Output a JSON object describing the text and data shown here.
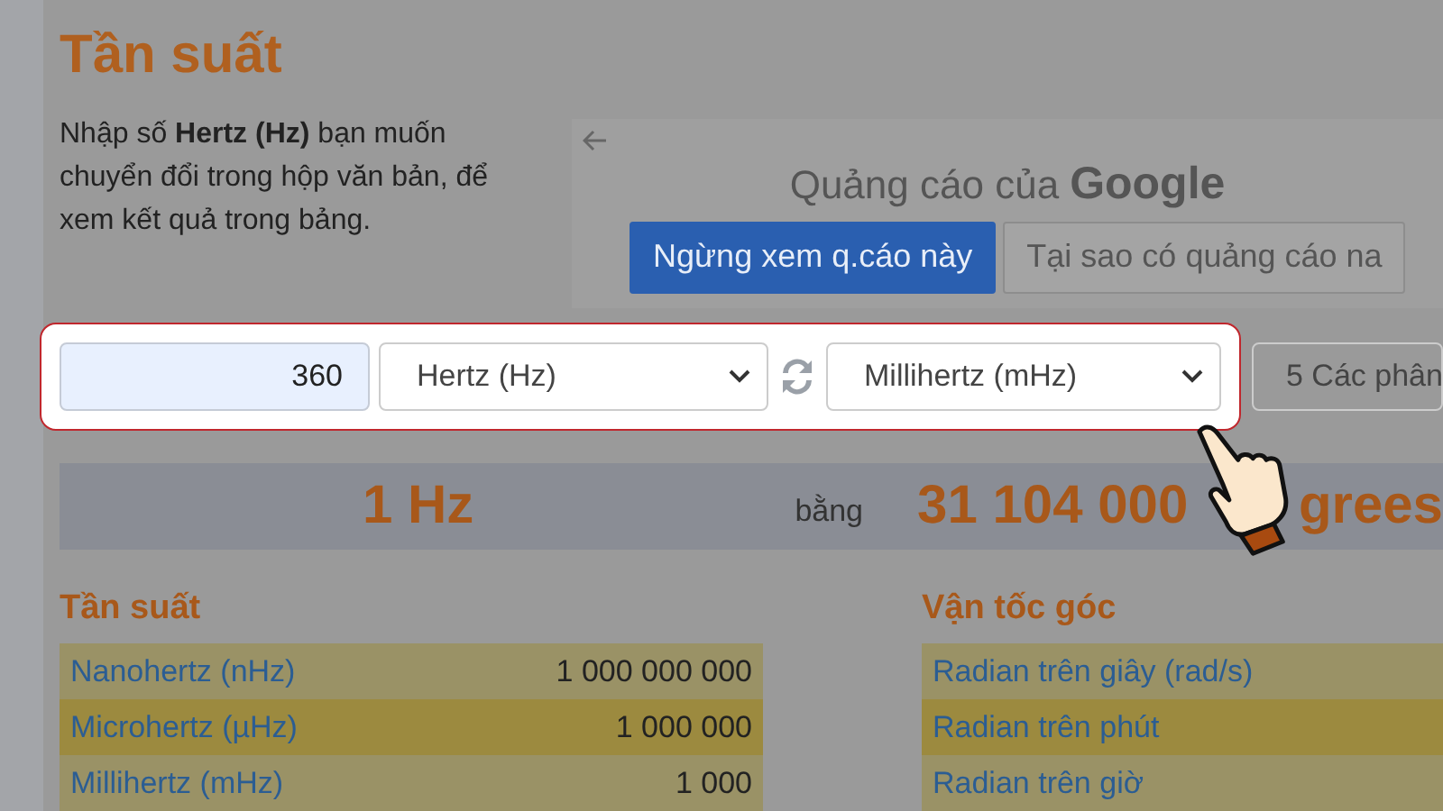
{
  "title": "Tần suất",
  "intro": "Nhập số **Hertz (Hz)** bạn muốn chuyển đổi trong hộp văn bản, để xem kết quả trong bảng.",
  "ad": {
    "label": "Quảng cáo của",
    "brand": "Google",
    "buttons": [
      {
        "label": "Ngừng xem q.cáo này",
        "kind": "primary"
      },
      {
        "label": "Tại sao có quảng cáo na",
        "kind": "secondary"
      }
    ]
  },
  "converter": {
    "value": "360",
    "from_unit": "Hertz (Hz)",
    "to_unit": "Millihertz (mHz)",
    "decimals": "5 Các phân"
  },
  "result": {
    "from": "1 Hz",
    "equals": "bằng",
    "to": "31 104 000",
    "to_unit_fragment": "grees"
  },
  "sections": [
    {
      "title": "Tần suất",
      "rows": [
        {
          "name": "Nanohertz (nHz)",
          "value": "1 000 000 000"
        },
        {
          "name": "Microhertz (µHz)",
          "value": "1 000 000"
        },
        {
          "name": "Millihertz (mHz)",
          "value": "1 000"
        }
      ]
    },
    {
      "title": "Vận tốc góc",
      "rows": [
        {
          "name": "Radian trên giây (rad/s)"
        },
        {
          "name": "Radian trên phút"
        },
        {
          "name": "Radian trên giờ"
        }
      ]
    }
  ]
}
